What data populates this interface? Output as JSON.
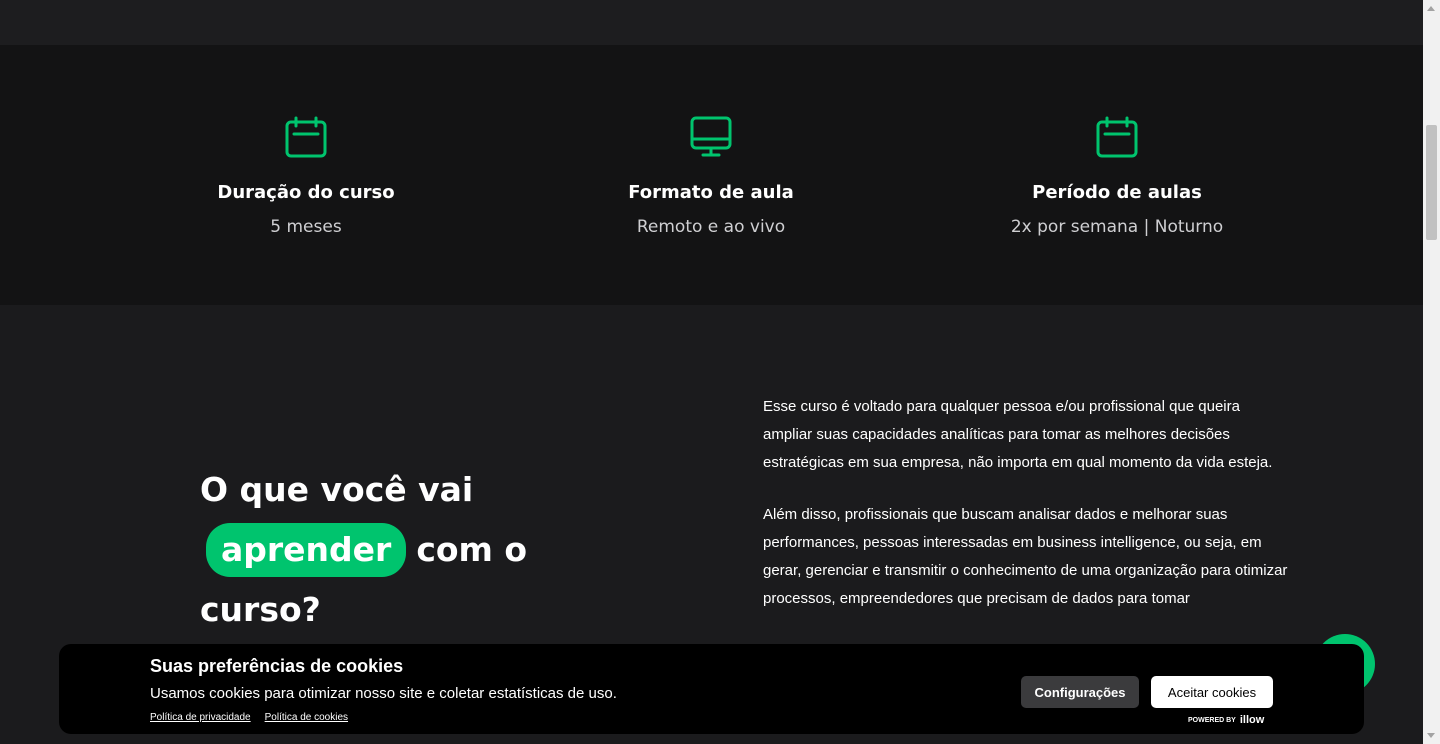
{
  "features": [
    {
      "icon": "calendar-icon",
      "title": "Duração do curso",
      "value": "5 meses"
    },
    {
      "icon": "monitor-icon",
      "title": "Formato de aula",
      "value": "Remoto e ao vivo"
    },
    {
      "icon": "calendar-icon",
      "title": "Período de aulas",
      "value": "2x por semana | Noturno"
    }
  ],
  "learn": {
    "heading_part1": "O que você vai",
    "heading_highlight": "aprender",
    "heading_part2": "com o",
    "heading_part3": "curso?",
    "paragraphs": [
      "Esse curso é voltado para qualquer pessoa e/ou profissional que queira ampliar suas capacidades analíticas para tomar as melhores decisões estratégicas em sua empresa, não importa em qual momento da vida esteja.",
      "Além disso, profissionais que buscam analisar dados e melhorar suas performances, pessoas interessadas em business intelligence, ou seja, em gerar, gerenciar e transmitir o conhecimento de uma organização para otimizar processos, empreendedores que precisam de dados para tomar"
    ]
  },
  "cookie": {
    "title": "Suas preferências de cookies",
    "text": "Usamos cookies para otimizar nosso site e coletar estatísticas de uso.",
    "privacy_link": "Política de privacidade",
    "cookie_link": "Política de cookies",
    "config_button": "Configurações",
    "accept_button": "Aceitar cookies",
    "powered_by": "POWERED BY",
    "brand": "illow"
  },
  "colors": {
    "accent": "#00c46e",
    "background": "#1b1b1d",
    "band": "#131314"
  }
}
